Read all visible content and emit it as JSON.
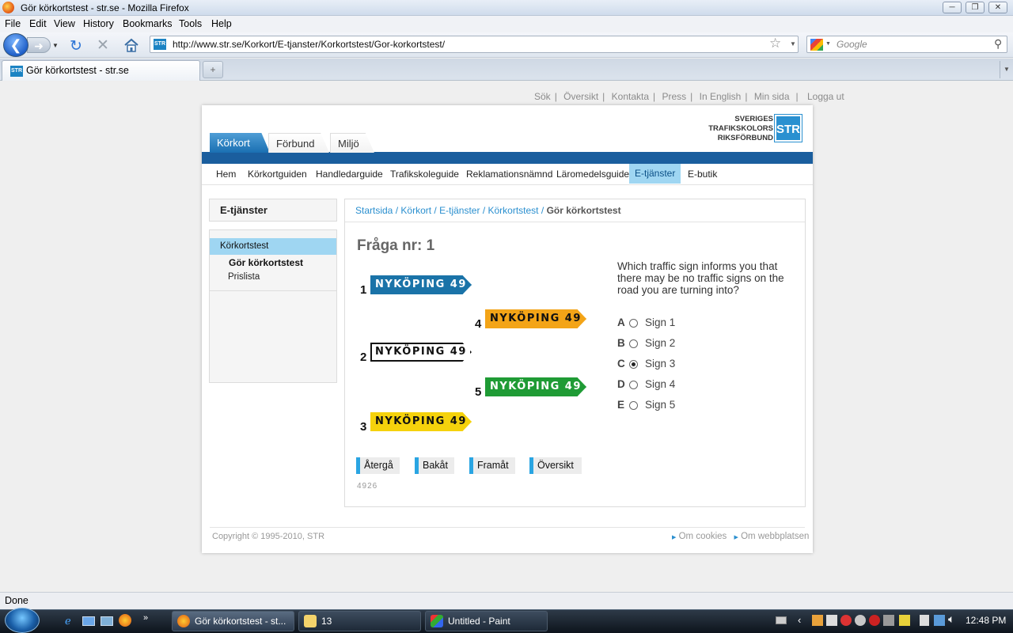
{
  "window": {
    "title": "Gör körkortstest - str.se - Mozilla Firefox"
  },
  "menu": [
    "File",
    "Edit",
    "View",
    "History",
    "Bookmarks",
    "Tools",
    "Help"
  ],
  "toolbar": {
    "url": "http://www.str.se/Korkort/E-tjanster/Korkortstest/Gor-korkortstest/",
    "search_placeholder": "Google",
    "site_icon": "STR"
  },
  "tabs": [
    {
      "label": "Gör körkortstest - str.se",
      "icon": "STR"
    }
  ],
  "site": {
    "util_links": [
      "Sök",
      "Översikt",
      "Kontakta",
      "Press",
      "In English",
      "Min sida",
      "Logga ut"
    ],
    "main_tabs": [
      "Körkort",
      "Förbund",
      "Miljö"
    ],
    "logo": {
      "line1": "SVERIGES",
      "line2": "TRAFIKSKOLORS",
      "line3": "RIKSFÖRBUND",
      "mark": "STR"
    },
    "subnav": [
      "Hem",
      "Körkortguiden",
      "Handledarguide",
      "Trafikskoleguide",
      "Reklamationsnämnd",
      "Läromedelsguide",
      "E-tjänster",
      "E-butik"
    ],
    "sidebar": {
      "title": "E-tjänster",
      "items": [
        "Körkortstest",
        "Gör körkortstest",
        "Prislista"
      ]
    },
    "breadcrumb": {
      "links": [
        "Startsida",
        "Körkort",
        "E-tjänster",
        "Körkortstest"
      ],
      "current": "Gör körkortstest"
    },
    "question": {
      "title": "Fråga nr: 1",
      "text": "Which traffic sign informs you that there may be no traffic signs on the road you are turning into?",
      "signs": [
        {
          "num": "1",
          "text": "NYKÖPING 49",
          "bg": "#1a73a8",
          "fg": "#ffffff"
        },
        {
          "num": "2",
          "text": "NYKÖPING 49",
          "bg": "#ffffff",
          "fg": "#111111"
        },
        {
          "num": "3",
          "text": "NYKÖPING 49",
          "bg": "#f5d20c",
          "fg": "#111111"
        },
        {
          "num": "4",
          "text": "NYKÖPING 49",
          "bg": "#f3a417",
          "fg": "#111111"
        },
        {
          "num": "5",
          "text": "NYKÖPING 49",
          "bg": "#1f9b35",
          "fg": "#ffffff"
        }
      ],
      "options": [
        {
          "letter": "A",
          "label": "Sign 1",
          "selected": false
        },
        {
          "letter": "B",
          "label": "Sign 2",
          "selected": false
        },
        {
          "letter": "C",
          "label": "Sign 3",
          "selected": true
        },
        {
          "letter": "D",
          "label": "Sign 4",
          "selected": false
        },
        {
          "letter": "E",
          "label": "Sign 5",
          "selected": false
        }
      ],
      "buttons": [
        "Återgå",
        "Bakåt",
        "Framåt",
        "Översikt"
      ],
      "id": "4926"
    },
    "footer": {
      "copyright": "Copyright © 1995-2010, STR",
      "links": [
        "Om cookies",
        "Om webbplatsen"
      ]
    }
  },
  "status": "Done",
  "taskbar": {
    "buttons": [
      "Gör körkortstest - st...",
      "13",
      "Untitled - Paint"
    ],
    "clock": "12:48 PM"
  }
}
